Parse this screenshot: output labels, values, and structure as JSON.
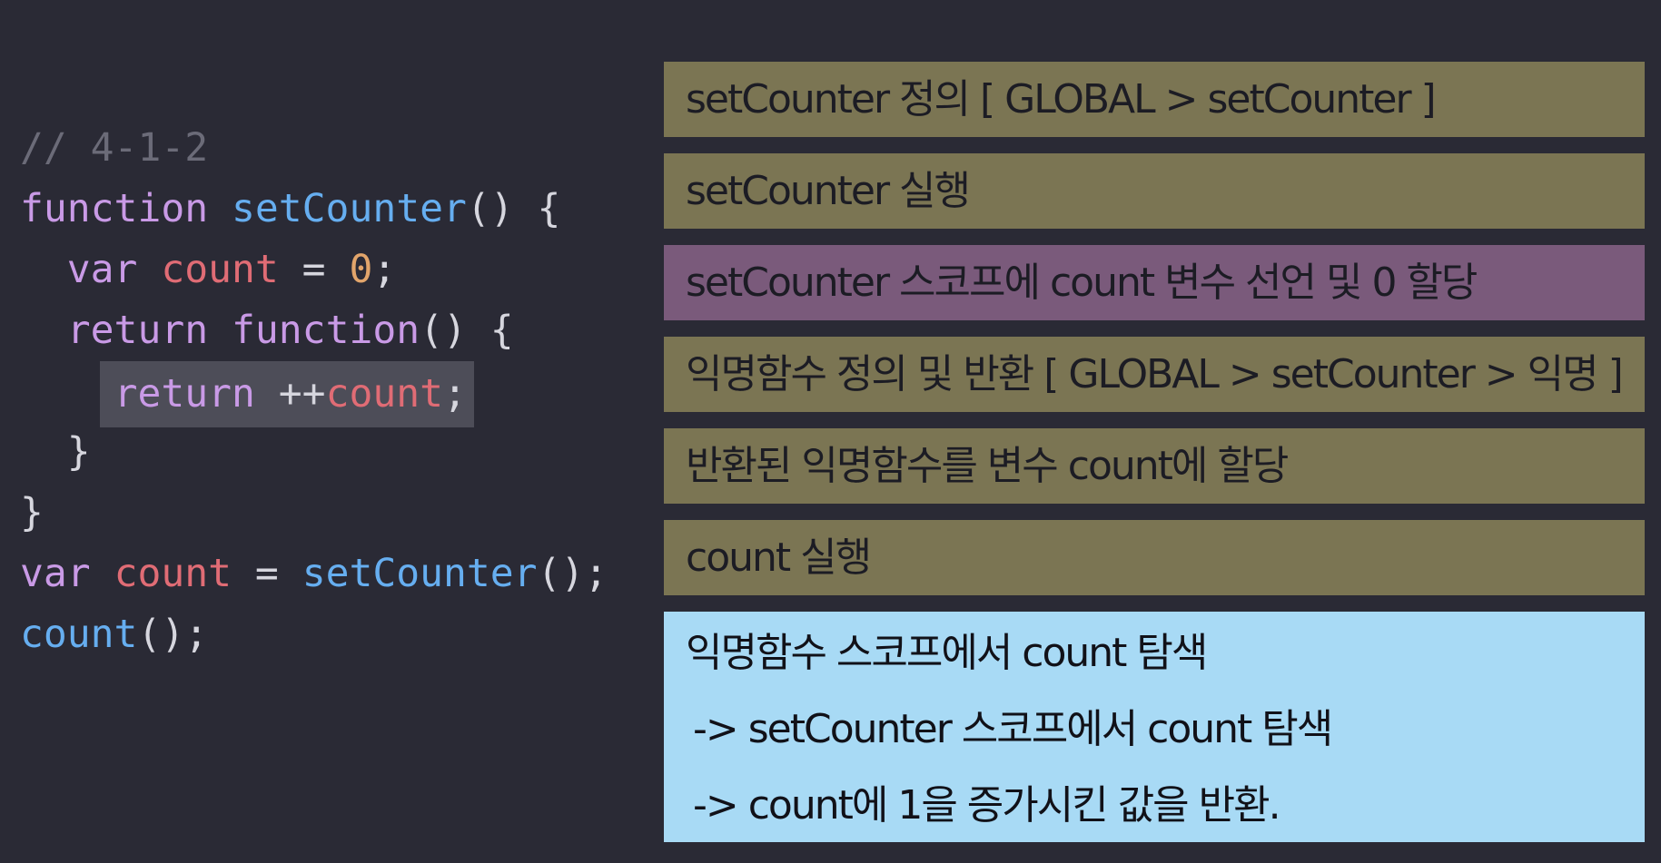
{
  "code": {
    "comment": "// 4-1-2",
    "kw_function": "function",
    "fn_setCounter": "setCounter",
    "parens_brace": "() {",
    "kw_var": "var",
    "var_count": "count",
    "eq": " = ",
    "zero": "0",
    "semi": ";",
    "kw_return": "return",
    "inc": "++",
    "close_brace": "}",
    "call_parens_semi": "();",
    "fn_count": "count"
  },
  "steps": [
    {
      "text": "setCounter 정의 [ GLOBAL > setCounter ]",
      "color": "#7b7553"
    },
    {
      "text": "setCounter 실행",
      "color": "#7b7553"
    },
    {
      "text": "setCounter 스코프에 count 변수 선언 및 0 할당",
      "color": "#7a5a7b"
    },
    {
      "text": "익명함수 정의 및 반환 [ GLOBAL > setCounter > 익명 ]",
      "color": "#7b7553"
    },
    {
      "text": "반환된 익명함수를 변수 count에 할당",
      "color": "#7b7553"
    },
    {
      "text": "count 실행",
      "color": "#7b7553"
    }
  ],
  "detail": {
    "line1": "익명함수 스코프에서 count 탐색",
    "line2": "-> setCounter 스코프에서 count 탐색",
    "line3": "-> count에 1을 증가시킨 값을 반환.",
    "color": "#a8daf5"
  }
}
